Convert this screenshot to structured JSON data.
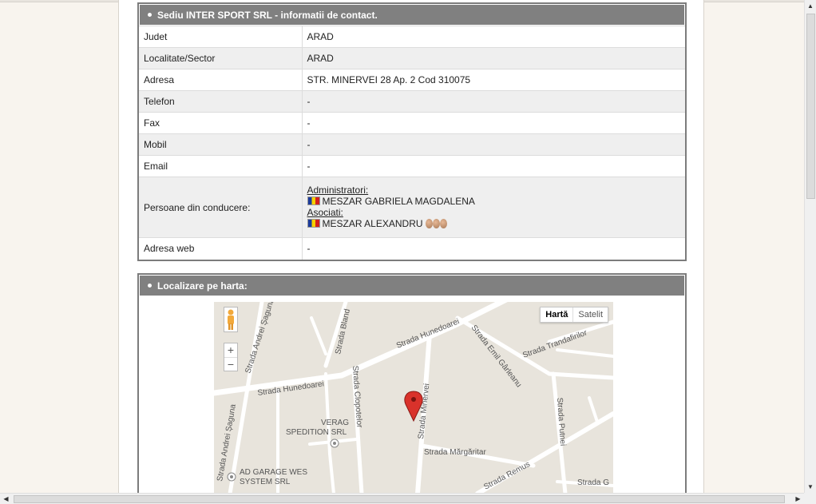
{
  "contact": {
    "title": "Sediu INTER SPORT SRL - informatii de contact.",
    "rows": [
      {
        "label": "Judet",
        "value": "ARAD"
      },
      {
        "label": "Localitate/Sector",
        "value": "ARAD"
      },
      {
        "label": "Adresa",
        "value": "STR. MINERVEI 28 Ap. 2 Cod 310075"
      },
      {
        "label": "Telefon",
        "value": "-"
      },
      {
        "label": "Fax",
        "value": "-"
      },
      {
        "label": "Mobil",
        "value": "-"
      },
      {
        "label": "Email",
        "value": "-"
      }
    ],
    "management": {
      "label": "Persoane din conducere:",
      "admins_heading": "Administratori:",
      "admin_name": "MESZAR GABRIELA MAGDALENA",
      "associates_heading": "Asociati:",
      "associate_name": "MESZAR ALEXANDRU"
    },
    "web": {
      "label": "Adresa web",
      "value": "-"
    }
  },
  "map": {
    "title": "Localizare pe harta:",
    "type_map": "Hartă",
    "type_satellite": "Satelit",
    "zoom_in": "+",
    "zoom_out": "−",
    "streets": {
      "hunedoarei_left": "Strada Hunedoarei",
      "hunedoarei_right": "Strada Hunedoarei",
      "andrei_saguna_top": "Strada Andrei Șaguna",
      "andrei_saguna_bottom": "Strada Andrei Șaguna",
      "bland": "Strada Bland",
      "clopotelor": "Strada Clopotelor",
      "minervei": "Strada Minervei",
      "emil_garleanu": "Strada Emil Gârleanu",
      "trandafirilor": "Strada Trandafirilor",
      "putnei": "Strada Putnei",
      "margaritar": "Strada Mărgăritar",
      "remus": "Strada Remus",
      "g": "Strada G"
    },
    "pois": {
      "verag_1": "VERAG",
      "verag_2": "SPEDITION SRL",
      "ad_1": "AD GARAGE WES",
      "ad_2": "SYSTEM SRL"
    }
  },
  "colors": {
    "header_bg": "#808080",
    "marker": "#d9322b",
    "map_bg": "#e8e4dc"
  }
}
